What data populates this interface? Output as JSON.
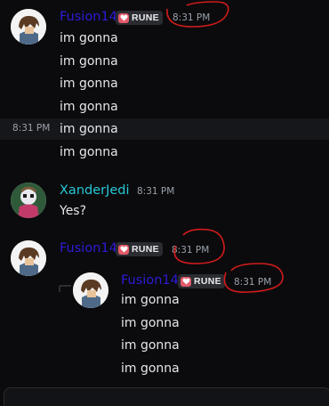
{
  "group1": {
    "username": "Fusion14",
    "badge": "RUNE",
    "timestamp": "8:31 PM",
    "messages": [
      "im gonna",
      "im gonna",
      "im gonna",
      "im gonna",
      "im gonna",
      "im gonna"
    ],
    "hover_timestamp": "8:31 PM"
  },
  "group2": {
    "username": "XanderJedi",
    "timestamp": "8:31 PM",
    "message": "Yes?"
  },
  "group3": {
    "username": "Fusion14",
    "badge": "RUNE",
    "timestamp": "8:31 PM"
  },
  "group4": {
    "username": "Fusion14",
    "badge": "RUNE",
    "timestamp": "8:31 PM",
    "messages": [
      "im gonna",
      "im gonna",
      "im gonna",
      "im gonna"
    ]
  },
  "colors": {
    "background": "#0b0b0d",
    "fusion_name": "#2d1bd6",
    "xander_name": "#27c8d8",
    "annotation": "#d31b1b",
    "badge_heart": "#e25a6a"
  }
}
